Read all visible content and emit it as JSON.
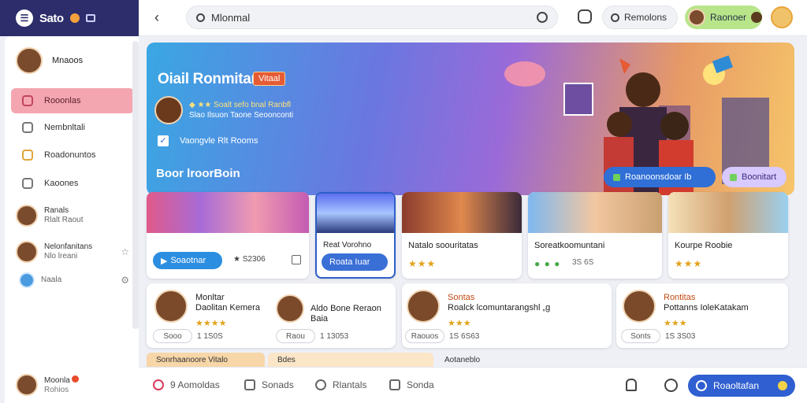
{
  "brand": {
    "name": "Sato"
  },
  "topbar": {
    "search_value": "Mlonmal",
    "search2_label": "Remolons",
    "user_label": "Raonoer"
  },
  "sidebar": {
    "profile_name": "Mnaoos",
    "items": [
      {
        "label": "Rooonlas"
      },
      {
        "label": "Nembnltali"
      },
      {
        "label": "Roadonuntos"
      },
      {
        "label": "Kaoones"
      }
    ],
    "people": [
      {
        "name": "Ranals",
        "sub": "Rlalt Raout"
      },
      {
        "name": "Nelonfanitans",
        "sub": "Nlo lreani"
      },
      {
        "name": "Naala",
        "sub": ""
      }
    ],
    "footer_name": "Moonla",
    "footer_sub": "Rohios"
  },
  "hero": {
    "title": "Oiail Ronmitan",
    "badge": "Vitaal",
    "person_line1": "◆ ★★ Soalt sefo bnal Ranbfl",
    "person_line2": "Slao Ilsuon Taone Seoonconti",
    "check_label": "Vaongvle Rlt Rooms",
    "section": "Boor lroorBoin",
    "btn1": "Roanoonsdoar Ib",
    "btn2": "Boonitart"
  },
  "media_cards": [
    {
      "btn": "Soaotnar",
      "count": "★ S2306"
    },
    {
      "title": "Reat Vorohno",
      "btn": "Roata Iuar"
    },
    {
      "title": "Natalo soouritatas",
      "stars": "★★★"
    },
    {
      "title": "Soreatkoomuntani",
      "meta": "3S 6S"
    },
    {
      "title": "Kourpe Roobie",
      "stars": "★★★"
    }
  ],
  "people_cards": [
    {
      "name": "Monltar",
      "sub": "Daolitan Kemera",
      "stars": "★★★★",
      "pill": "Sooo",
      "count": "1 1S0S"
    },
    {
      "name": "Aldo Bone Reraon",
      "sub": "Baia",
      "count": "1 13053",
      "pill": "Raou"
    },
    {
      "name": "Sontas",
      "sub": "Roalck lcomuntarangshl „g",
      "stars": "★★★",
      "pill": "Raouos",
      "count": "1S 6S63"
    },
    {
      "name": "Rontitas",
      "sub": "Pottanns IoleKatakam",
      "stars": "★★★",
      "pill": "Sonts",
      "count": "1S 3S03"
    }
  ],
  "strips": [
    "Sonrhaanoore Vitalo",
    "Bdes",
    "Aotaneblo"
  ],
  "bottombar": {
    "items": [
      "9 Aomoldas",
      "Sonads",
      "Rlantals",
      "Sonda"
    ],
    "cta": "Roaoltafan"
  },
  "colors": {
    "accent": "#2f5fd0",
    "active_nav": "#f4a6b0",
    "brand_bg": "#2c2d6a"
  }
}
